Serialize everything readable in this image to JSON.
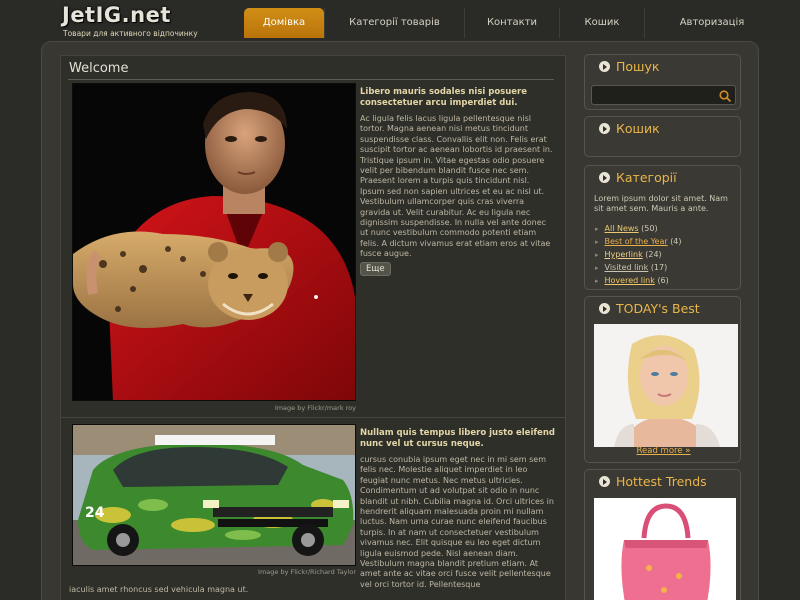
{
  "site": {
    "logo": "JetIG.net",
    "slogan": "Товари для активного відпочинку"
  },
  "nav": {
    "items": [
      "Домівка",
      "Категорії товарів",
      "Контакти",
      "Кошик",
      "Авторизація"
    ],
    "active_index": 0
  },
  "main": {
    "title": "Welcome",
    "post1": {
      "heading": "Libero mauris sodales nisi posuere consectetuer arcu imperdiet dui.",
      "body": "Ac ligula felis lacus ligula pellentesque nisl tortor. Magna aenean nisi metus tincidunt suspendisse class. Convallis elit non. Felis erat suscipit tortor ac aenean lobortis id praesent in. Tristique ipsum in. Vitae egestas odio posuere velit per bibendum blandit fusce nec sem. Praesent lorem a turpis quis tincidunt nisl. Ipsum sed non sapien ultrices et eu ac nisl ut. Vestibulum ullamcorper quis cras viverra gravida ut. Velit curabitur. Ac eu ligula nec dignissim suspendisse. In nulla vel ante donec ut nunc vestibulum commodo potenti etiam felis. A dictum vivamus erat etiam eros at vitae fusce augue.",
      "more_label": "Еще",
      "image_caption": "Image by Flickr/mark roy"
    },
    "post2": {
      "heading": "Nullam quis tempus libero justo eleifend nunc vel ut cursus neque.",
      "body": "cursus conubia ipsum eget nec in mi sem sem felis nec. Molestie aliquet imperdiet in leo feugiat nunc metus. Nec metus ultricies. Condimentum ut ad volutpat sit odio in nunc blandit ut nibh. Cubilia magna id. Orci ultrices in hendrerit aliquam malesuada proin mi nullam luctus. Nam urna curae nunc eleifend faucibus turpis. In at nam ut consectetuer vestibulum vivamus nec. Elit quisque eu leo eget dictum ligula euismod pede. Nisl aenean diam. Vestibulum magna blandit pretium etiam. At amet ante ac vitae orci fusce velit pellentesque vel orci tortor id. Pellentesque",
      "tail": "iaculis amet rhoncus sed vehicula magna ut.",
      "image_caption": "Image by Flickr/Richard Taylor"
    }
  },
  "sidebar": {
    "search": {
      "title": "Пошук",
      "placeholder": ""
    },
    "cart": {
      "title": "Кошик"
    },
    "categories": {
      "title": "Категорії",
      "description": "Lorem ipsum dolor sit amet. Nam sit amet sem. Mauris a ante.",
      "items": [
        {
          "label": "All News",
          "count": "(50)"
        },
        {
          "label": "Best of the Year",
          "count": "(4)"
        },
        {
          "label": "Hyperlink",
          "count": "(24)"
        },
        {
          "label": "Visited link",
          "count": "(17)"
        },
        {
          "label": "Hovered link",
          "count": "(6)"
        }
      ]
    },
    "todays_best": {
      "title": "TODAY's Best",
      "read_more": "Read more »"
    },
    "hottest_trends": {
      "title": "Hottest Trends"
    }
  },
  "colors": {
    "accent": "#e8b04b",
    "nav_active": "#c8810f",
    "background": "#2b2b27"
  }
}
